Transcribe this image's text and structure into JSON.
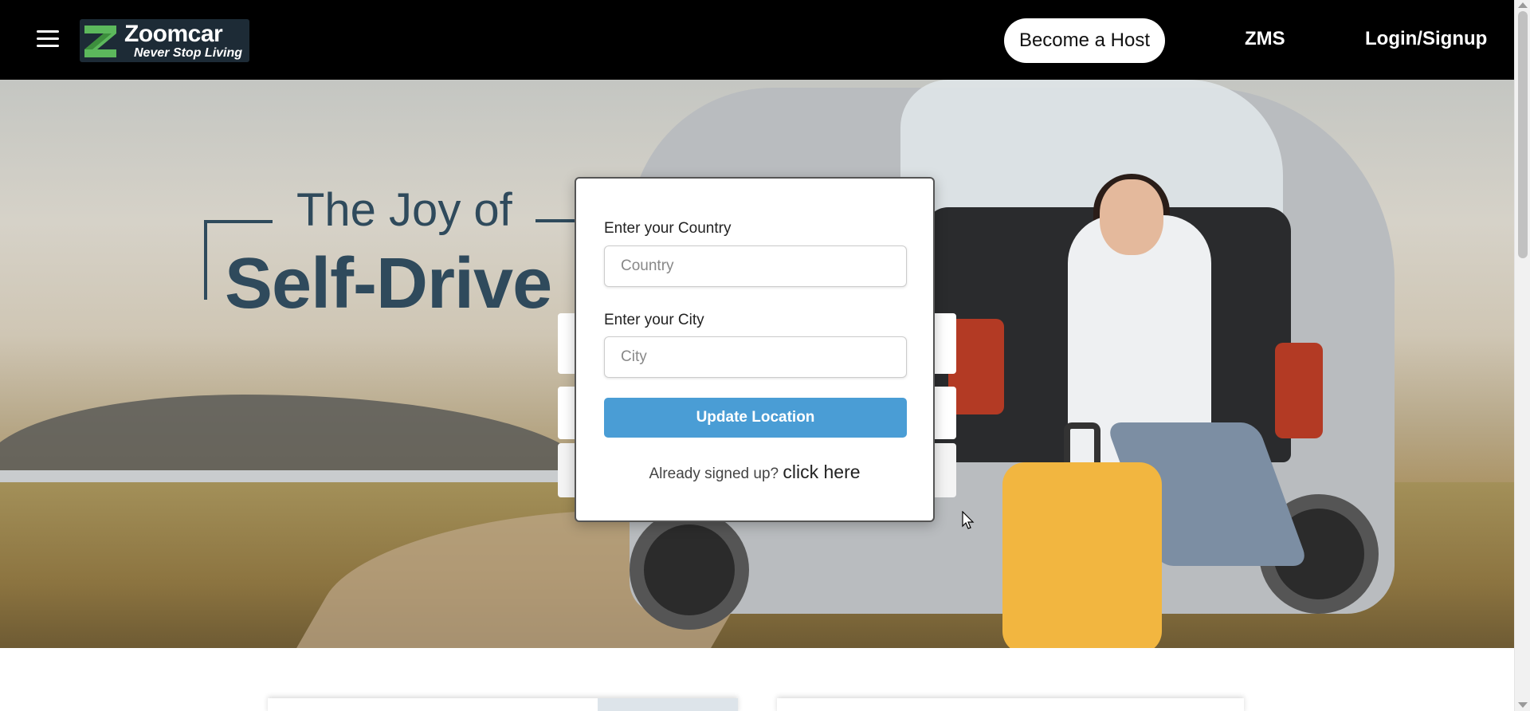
{
  "header": {
    "logo": {
      "name": "Zoomcar",
      "tagline": "Never Stop Living"
    },
    "become_host": "Become a Host",
    "zms": "ZMS",
    "login": "Login/Signup"
  },
  "hero": {
    "title_line": "The Joy of",
    "title_bold": "Self-Drive"
  },
  "location_modal": {
    "country_label": "Enter your Country",
    "country_placeholder": "Country",
    "country_value": "",
    "city_label": "Enter your City",
    "city_placeholder": "City",
    "city_value": "",
    "update_button": "Update Location",
    "signed_up_text": "Already signed up?",
    "click_here": "click here"
  },
  "colors": {
    "header_bg": "#000000",
    "primary_button": "#4a9dd5",
    "title_text": "#2f4a5c",
    "logo_green": "#5cb85c"
  },
  "icons": [
    "hamburger-menu-icon",
    "zoomcar-logo-icon",
    "mouse-cursor-icon"
  ]
}
